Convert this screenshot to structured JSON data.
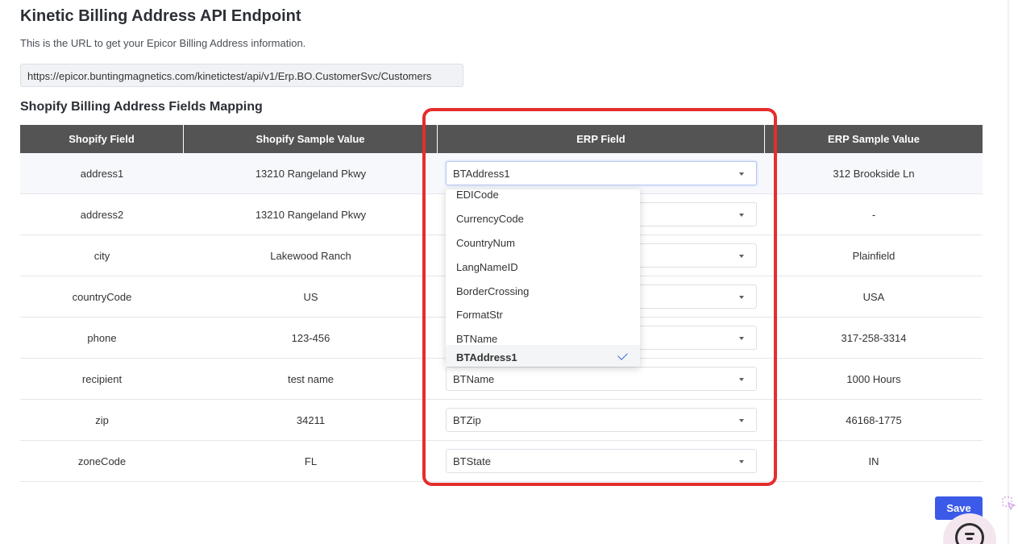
{
  "header": {
    "title": "Kinetic Billing Address API Endpoint",
    "description": "This is the URL to get your Epicor Billing Address information.",
    "endpoint_url": "https://epicor.buntingmagnetics.com/kinetictest/api/v1/Erp.BO.CustomerSvc/Customers"
  },
  "mapping": {
    "title": "Shopify Billing Address Fields Mapping",
    "columns": [
      "Shopify Field",
      "Shopify Sample Value",
      "ERP Field",
      "ERP Sample Value"
    ],
    "rows": [
      {
        "shopify_field": "address1",
        "shopify_sample": "13210 Rangeland Pkwy",
        "erp_field": "BTAddress1",
        "erp_sample": "312 Brookside Ln"
      },
      {
        "shopify_field": "address2",
        "shopify_sample": "13210 Rangeland Pkwy",
        "erp_field": "",
        "erp_sample": "-"
      },
      {
        "shopify_field": "city",
        "shopify_sample": "Lakewood Ranch",
        "erp_field": "",
        "erp_sample": "Plainfield"
      },
      {
        "shopify_field": "countryCode",
        "shopify_sample": "US",
        "erp_field": "",
        "erp_sample": "USA"
      },
      {
        "shopify_field": "phone",
        "shopify_sample": "123-456",
        "erp_field": "",
        "erp_sample": "317-258-3314"
      },
      {
        "shopify_field": "recipient",
        "shopify_sample": "test name",
        "erp_field": "BTName",
        "erp_sample": "1000 Hours"
      },
      {
        "shopify_field": "zip",
        "shopify_sample": "34211",
        "erp_field": "BTZip",
        "erp_sample": "46168-1775"
      },
      {
        "shopify_field": "zoneCode",
        "shopify_sample": "FL",
        "erp_field": "BTState",
        "erp_sample": "IN"
      }
    ]
  },
  "dropdown": {
    "options": [
      "EDICode",
      "CurrencyCode",
      "CountryNum",
      "LangNameID",
      "BorderCrossing",
      "FormatStr",
      "BTName",
      "BTAddress1"
    ],
    "selected": "BTAddress1"
  },
  "actions": {
    "save_label": "Save"
  },
  "colors": {
    "header_bg": "#545454",
    "highlight_border": "#e52e2e",
    "save_button": "#3b5ae8",
    "check_mark": "#3a6be0"
  },
  "icons": {
    "select_caret": "caret-down-icon",
    "selected_option": "check-icon",
    "chat_widget": "chat-icon",
    "cursor_widget": "cursor-select-icon"
  }
}
